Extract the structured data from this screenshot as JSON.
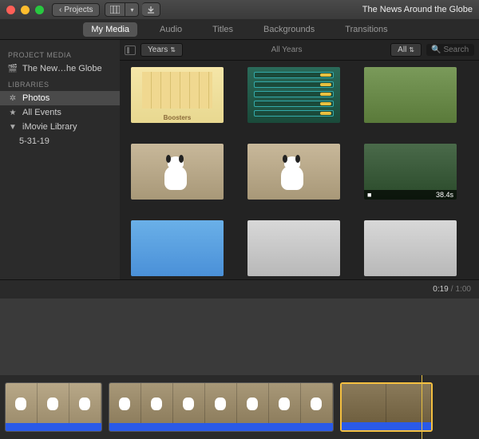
{
  "titlebar": {
    "back_label": "Projects",
    "project_title": "The News Around the Globe"
  },
  "tabs": {
    "my_media": "My Media",
    "audio": "Audio",
    "titles": "Titles",
    "backgrounds": "Backgrounds",
    "transitions": "Transitions"
  },
  "sidebar": {
    "header_project": "PROJECT MEDIA",
    "project_item": "The New…he Globe",
    "header_libraries": "LIBRARIES",
    "photos": "Photos",
    "all_events": "All Events",
    "imovie_library": "iMovie Library",
    "event1": "5-31-19"
  },
  "filter": {
    "scope": "Years",
    "crumb": "All Years",
    "filter_all": "All",
    "search_placeholder": "Search"
  },
  "grid": {
    "boosters_label": "Boosters",
    "video_duration": "38.4s"
  },
  "time": {
    "current": "0:19",
    "total": "1:00"
  }
}
